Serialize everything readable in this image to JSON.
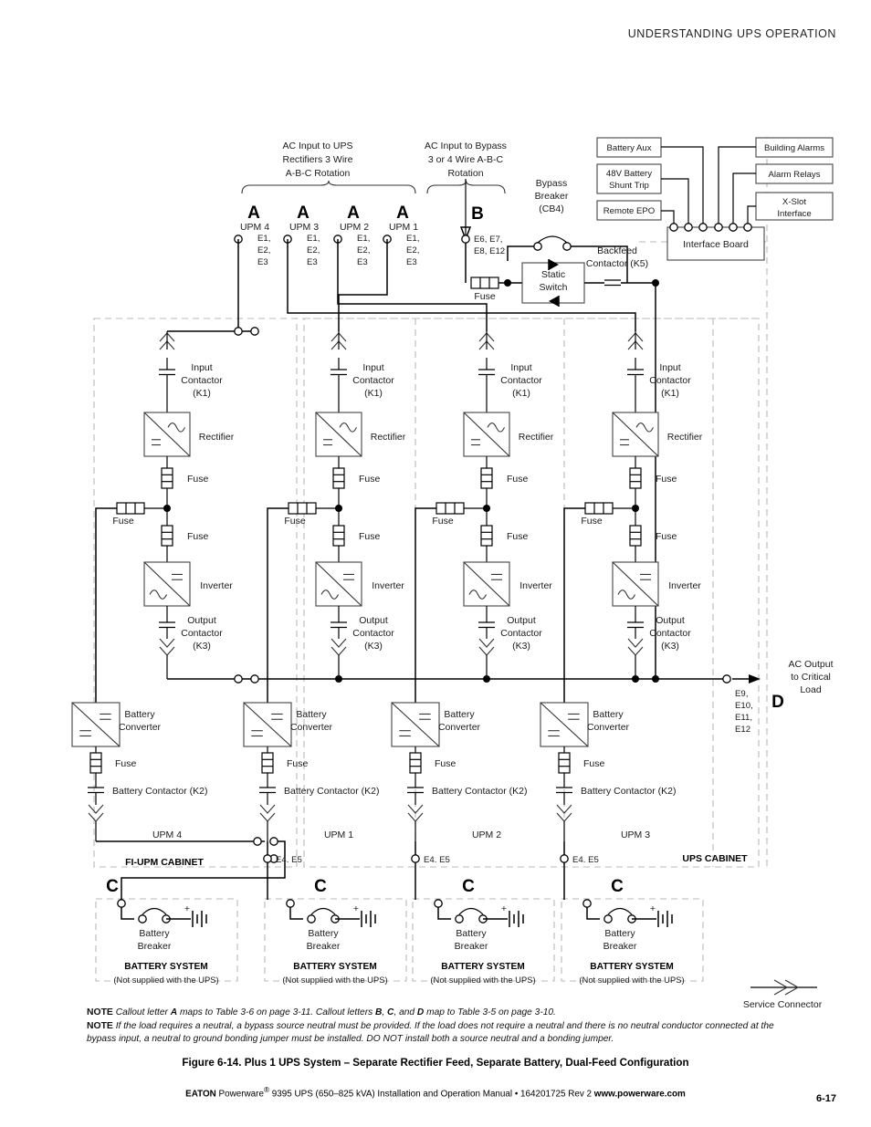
{
  "page": {
    "header": "UNDERSTANDING UPS OPERATION",
    "number": "6-17"
  },
  "inputs": {
    "rectifier_feed_label": [
      "AC Input to UPS",
      "Rectifiers 3 Wire",
      "A-B-C Rotation"
    ],
    "bypass_feed_label": [
      "AC Input to Bypass",
      "3 or 4 Wire A-B-C",
      "Rotation"
    ],
    "bypass_breaker_label": [
      "Bypass",
      "Breaker",
      "(CB4)"
    ]
  },
  "callouts": {
    "a": "A",
    "b": "B",
    "c": "C",
    "d": "D"
  },
  "upm_feeds": [
    {
      "name": "UPM 4",
      "terminals": [
        "E1,",
        "E2,",
        "E3"
      ]
    },
    {
      "name": "UPM 3",
      "terminals": [
        "E1,",
        "E2,",
        "E3"
      ]
    },
    {
      "name": "UPM 2",
      "terminals": [
        "E1,",
        "E2,",
        "E3"
      ]
    },
    {
      "name": "UPM 1",
      "terminals": [
        "E1,",
        "E2,",
        "E3"
      ]
    }
  ],
  "bypass": {
    "terminals": [
      "E6, E7,",
      "E8, E12"
    ],
    "fuse": "Fuse",
    "static_switch": [
      "Static",
      "Switch"
    ],
    "backfeed": [
      "Backfeed",
      "Contactor (K5)"
    ]
  },
  "interface": {
    "board": "Interface Board",
    "left_boxes": [
      "Battery Aux",
      "48V Battery\nShunt Trip",
      "Remote EPO"
    ],
    "left_boxes_lines": [
      [
        "Battery Aux"
      ],
      [
        "48V Battery",
        "Shunt Trip"
      ],
      [
        "Remote EPO"
      ]
    ],
    "right_boxes_lines": [
      [
        "Building Alarms"
      ],
      [
        "Alarm Relays"
      ],
      [
        "X-Slot",
        "Interface"
      ]
    ]
  },
  "module": {
    "input_contactor": [
      "Input",
      "Contactor",
      "(K1)"
    ],
    "rectifier": "Rectifier",
    "fuse": "Fuse",
    "inverter": "Inverter",
    "output_contactor": [
      "Output",
      "Contactor",
      "(K3)"
    ],
    "battery_converter": [
      "Battery",
      "Converter"
    ],
    "battery_contactor": "Battery Contactor (K2)"
  },
  "modules": [
    {
      "id": "UPM 4",
      "terminals": ""
    },
    {
      "id": "UPM 1",
      "terminals": "E4. E5"
    },
    {
      "id": "UPM 2",
      "terminals": "E4. E5"
    },
    {
      "id": "UPM 3",
      "terminals": "E4. E5"
    }
  ],
  "cabinets": {
    "fi_upm": "FI-UPM CABINET",
    "ups": "UPS CABINET"
  },
  "battery_systems": [
    {
      "breaker": [
        "Battery",
        "Breaker"
      ],
      "title": "BATTERY SYSTEM",
      "sub": "(Not supplied with the UPS)",
      "polarity": "+"
    },
    {
      "breaker": [
        "Battery",
        "Breaker"
      ],
      "title": "BATTERY SYSTEM",
      "sub": "(Not supplied with the UPS)",
      "polarity": "+"
    },
    {
      "breaker": [
        "Battery",
        "Breaker"
      ],
      "title": "BATTERY SYSTEM",
      "sub": "(Not supplied with the UPS)",
      "polarity": "+"
    },
    {
      "breaker": [
        "Battery",
        "Breaker"
      ],
      "title": "BATTERY SYSTEM",
      "sub": "(Not supplied with the UPS)",
      "polarity": "+"
    }
  ],
  "output": {
    "label": [
      "AC Output",
      "to Critical",
      "Load"
    ],
    "terminals": [
      "E9,",
      "E10,",
      "E11,",
      "E12"
    ]
  },
  "legend": {
    "service_connector": "Service  Connector"
  },
  "notes": {
    "note_label": "NOTE",
    "note1_parts": [
      "Callout letter ",
      "A",
      " maps to Table 3-6 on page 3-11. Callout letters ",
      "B",
      ", ",
      "C",
      ", and ",
      "D",
      " map to Table 3-5 on page 3-10."
    ],
    "note2": "If the load requires a neutral, a bypass source neutral must be provided. If the load does not require a neutral and there is no neutral conductor connected at the bypass input, a neutral to ground bonding jumper must be installed. DO NOT install both a source neutral and a bonding jumper."
  },
  "figure": {
    "caption": "Figure 6-14. Plus 1 UPS System – Separate Rectifier Feed, Separate Battery, Dual-Feed Configuration"
  },
  "footer": {
    "brand": "EATON",
    "text1": " Powerware",
    "reg": "®",
    "text2": " 9395 UPS (650–825 kVA) Installation and Operation Manual  •  164201725 Rev 2 ",
    "url": "www.powerware.com"
  }
}
